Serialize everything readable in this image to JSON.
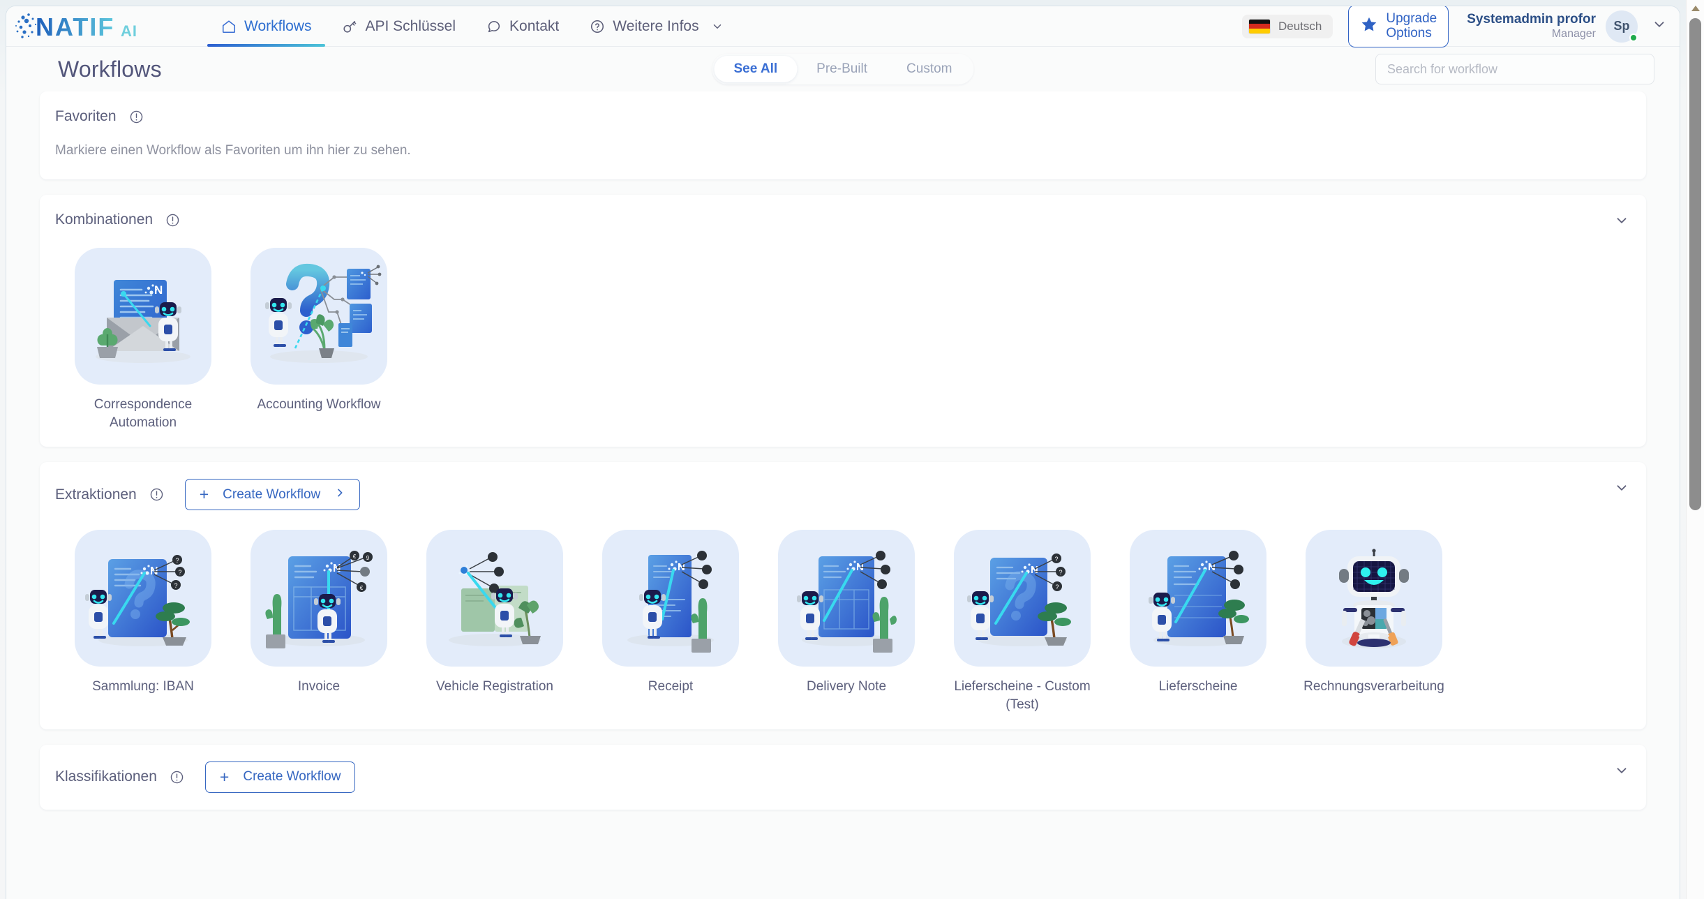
{
  "brand": {
    "name": "NATIF",
    "suffix": "AI"
  },
  "topnav": {
    "items": [
      {
        "label": "Workflows",
        "icon": "home-icon",
        "active": true
      },
      {
        "label": "API Schlüssel",
        "icon": "key-icon",
        "active": false
      },
      {
        "label": "Kontakt",
        "icon": "chat-bubble-icon",
        "active": false
      },
      {
        "label": "Weitere Infos",
        "icon": "question-circle-icon",
        "active": false,
        "has_chevron": true
      }
    ],
    "language": {
      "label": "Deutsch",
      "flag": "de-flag-icon"
    },
    "upgrade": {
      "line1": "Upgrade",
      "line2": "Options",
      "icon": "star-icon"
    },
    "user": {
      "name": "Systemadmin profor",
      "role": "Manager",
      "initials": "Sp",
      "status": "online"
    }
  },
  "subheader": {
    "title": "Workflows",
    "tabs": [
      {
        "label": "See All",
        "active": true
      },
      {
        "label": "Pre-Built",
        "active": false
      },
      {
        "label": "Custom",
        "active": false
      }
    ],
    "search": {
      "value": "",
      "placeholder": "Search for workflow"
    }
  },
  "sections": {
    "favoriten": {
      "title": "Favoriten",
      "empty_text": "Markiere einen Workflow als Favoriten um ihn hier zu sehen."
    },
    "kombinationen": {
      "title": "Kombinationen",
      "items": [
        {
          "label": "Correspondence Automation",
          "art": "envelope-document-robot-art"
        },
        {
          "label": "Accounting Workflow",
          "art": "question-mark-flow-robot-art"
        }
      ]
    },
    "extraktionen": {
      "title": "Extraktionen",
      "create_label": "Create Workflow",
      "items": [
        {
          "label": "Sammlung: IBAN",
          "art": "document-question-robot-art"
        },
        {
          "label": "Invoice",
          "art": "document-table-robot-art"
        },
        {
          "label": "Vehicle Registration",
          "art": "document-green-robot-art"
        },
        {
          "label": "Receipt",
          "art": "receipt-robot-art"
        },
        {
          "label": "Delivery Note",
          "art": "document-cactus-robot-art"
        },
        {
          "label": "Lieferscheine - Custom (Test)",
          "art": "document-question-robot-art"
        },
        {
          "label": "Lieferscheine",
          "art": "document-robot-art"
        },
        {
          "label": "Rechnungsverarbeitung",
          "art": "robot-tools-art"
        }
      ]
    },
    "klassifikationen": {
      "title": "Klassifikationen",
      "create_label": "Create Workflow"
    }
  },
  "colors": {
    "accent_blue": "#3667c1",
    "tab_active": "#3b6fd4",
    "tile_bg": "#e3ecfa",
    "text_muted": "#5c5f7c",
    "status_online": "#1faa4b"
  }
}
